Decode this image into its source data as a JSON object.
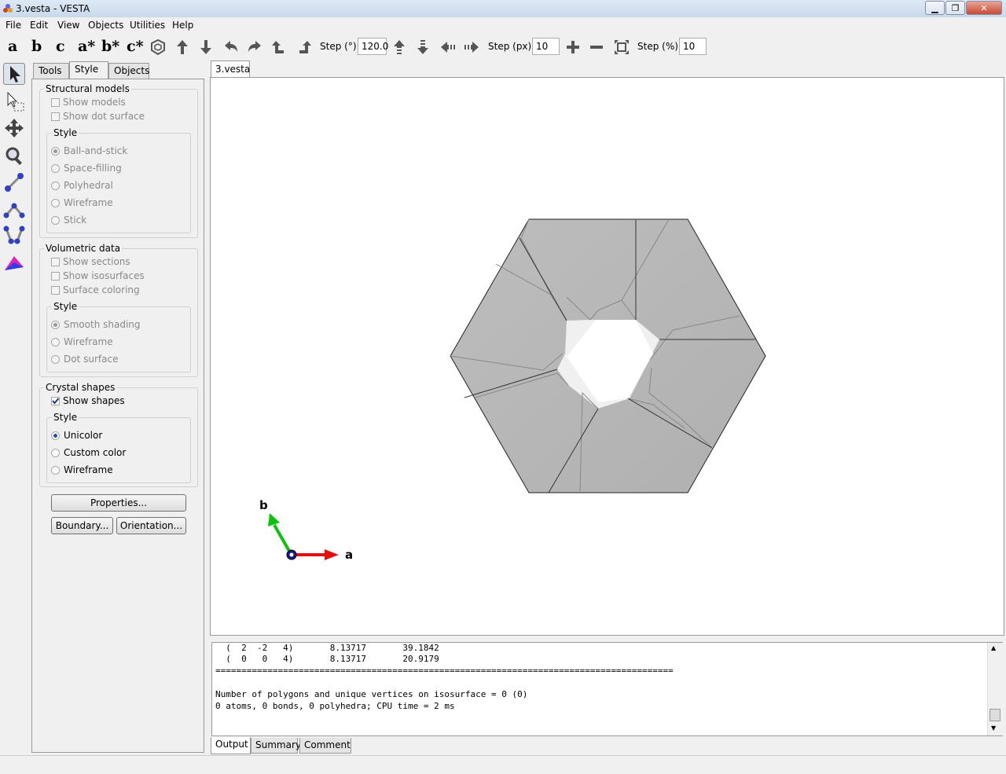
{
  "window": {
    "title": "3.vesta - VESTA"
  },
  "menu": [
    "File",
    "Edit",
    "View",
    "Objects",
    "Utilities",
    "Help"
  ],
  "toolbar": {
    "axis_buttons": [
      "a",
      "b",
      "c",
      "a*",
      "b*",
      "c*"
    ],
    "step_deg_label": "Step (°):",
    "step_deg_value": "120.0",
    "step_px_label": "Step (px):",
    "step_px_value": "10",
    "step_pct_label": "Step (%):",
    "step_pct_value": "10"
  },
  "tabs": {
    "tools": "Tools",
    "style": "Style",
    "objects": "Objects"
  },
  "structural": {
    "title": "Structural models",
    "show_models": "Show models",
    "show_dot_surface": "Show dot surface",
    "style_title": "Style",
    "styles": [
      "Ball-and-stick",
      "Space-filling",
      "Polyhedral",
      "Wireframe",
      "Stick"
    ]
  },
  "volumetric": {
    "title": "Volumetric data",
    "show_sections": "Show sections",
    "show_isosurfaces": "Show isosurfaces",
    "surface_coloring": "Surface coloring",
    "style_title": "Style",
    "styles": [
      "Smooth shading",
      "Wireframe",
      "Dot surface"
    ]
  },
  "crystal": {
    "title": "Crystal shapes",
    "show_shapes": "Show shapes",
    "show_shapes_checked": true,
    "style_title": "Style",
    "styles": [
      "Unicolor",
      "Custom color",
      "Wireframe"
    ]
  },
  "buttons": {
    "properties": "Properties...",
    "boundary": "Boundary...",
    "orientation": "Orientation..."
  },
  "document_tab": "3.vesta",
  "axes": {
    "a_label": "a",
    "b_label": "b"
  },
  "output": {
    "lines": [
      "  (  2  -2   4)       8.13717       39.1842",
      "  (  0   0   4)       8.13717       20.9179",
      "========================================================================================",
      "",
      "Number of polygons and unique vertices on isosurface = 0 (0)",
      "0 atoms, 0 bonds, 0 polyhedra; CPU time = 2 ms"
    ]
  },
  "bottom_tabs": [
    "Output",
    "Summary",
    "Comment"
  ],
  "colors": {
    "axis_a": "#e01010",
    "axis_b": "#10c010",
    "axis_c": "#1a1a8a",
    "crystal_face": "#b8b8b8"
  }
}
